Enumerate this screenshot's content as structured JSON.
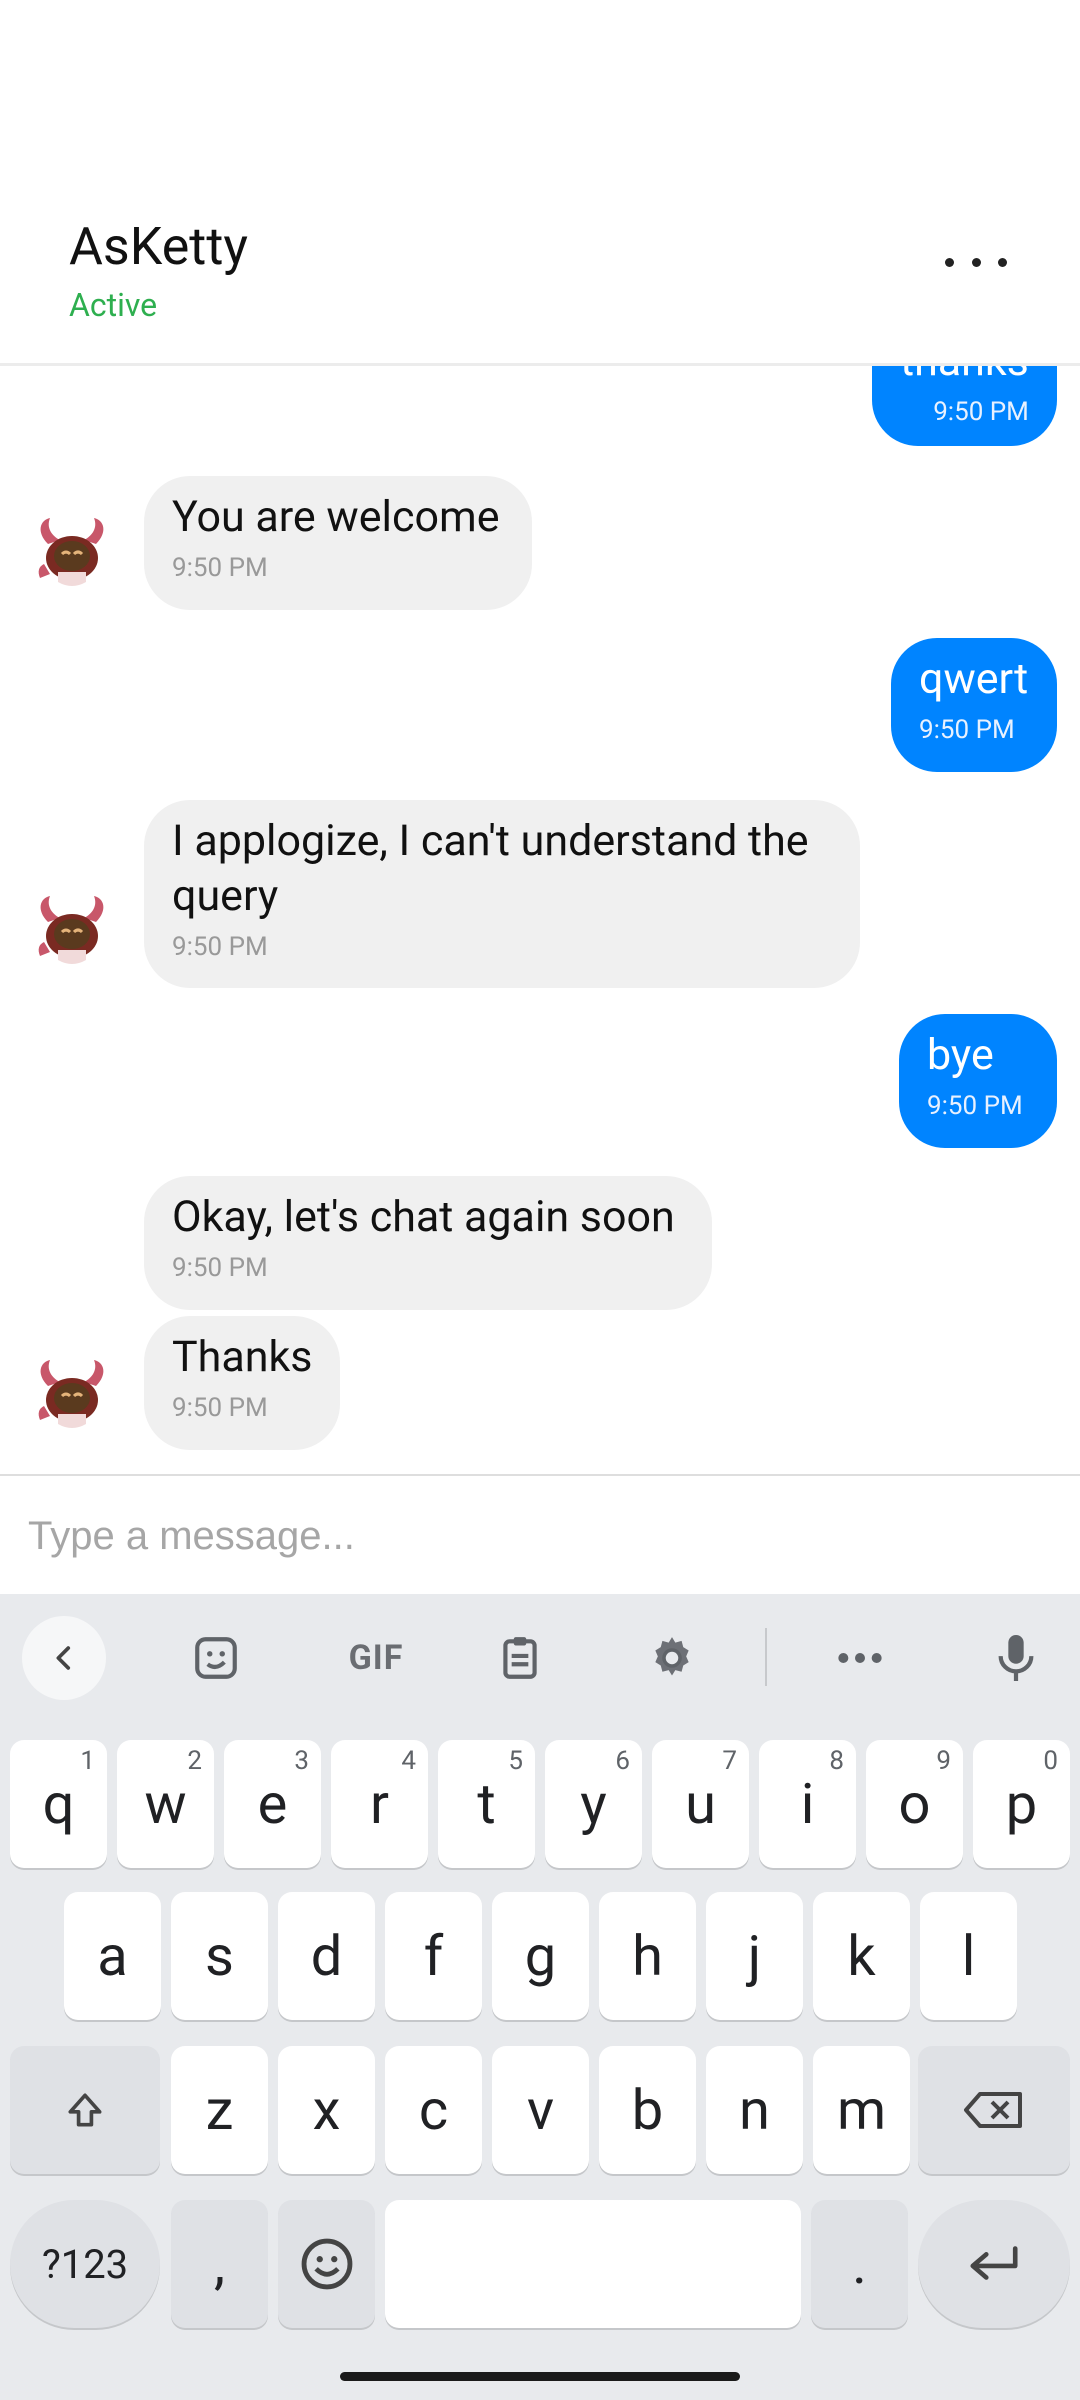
{
  "header": {
    "title": "AsKetty",
    "status": "Active"
  },
  "messages": [
    {
      "dir": "out",
      "text": "thanks",
      "time": "9:50 PM"
    },
    {
      "dir": "in",
      "text": "You are welcome",
      "time": "9:50 PM"
    },
    {
      "dir": "out",
      "text": "qwert",
      "time": "9:50 PM"
    },
    {
      "dir": "in",
      "text": "I applogize, I can't understand the query",
      "time": "9:50 PM"
    },
    {
      "dir": "out",
      "text": "bye",
      "time": "9:50 PM"
    },
    {
      "dir": "in",
      "text": "Okay, let's chat again soon",
      "time": "9:50 PM"
    },
    {
      "dir": "in",
      "text": "Thanks",
      "time": "9:50 PM"
    }
  ],
  "input": {
    "placeholder": "Type a message..."
  },
  "keyboard": {
    "toolbar": [
      "back-icon",
      "sticker-icon",
      "GIF",
      "clipboard-icon",
      "gear-icon",
      "more-icon",
      "mic-icon"
    ],
    "row1": [
      {
        "k": "q",
        "n": "1"
      },
      {
        "k": "w",
        "n": "2"
      },
      {
        "k": "e",
        "n": "3"
      },
      {
        "k": "r",
        "n": "4"
      },
      {
        "k": "t",
        "n": "5"
      },
      {
        "k": "y",
        "n": "6"
      },
      {
        "k": "u",
        "n": "7"
      },
      {
        "k": "i",
        "n": "8"
      },
      {
        "k": "o",
        "n": "9"
      },
      {
        "k": "p",
        "n": "0"
      }
    ],
    "row2": [
      "a",
      "s",
      "d",
      "f",
      "g",
      "h",
      "j",
      "k",
      "l"
    ],
    "row3": [
      "z",
      "x",
      "c",
      "v",
      "b",
      "n",
      "m"
    ],
    "symbols": "?123",
    "comma": ",",
    "period": "."
  }
}
